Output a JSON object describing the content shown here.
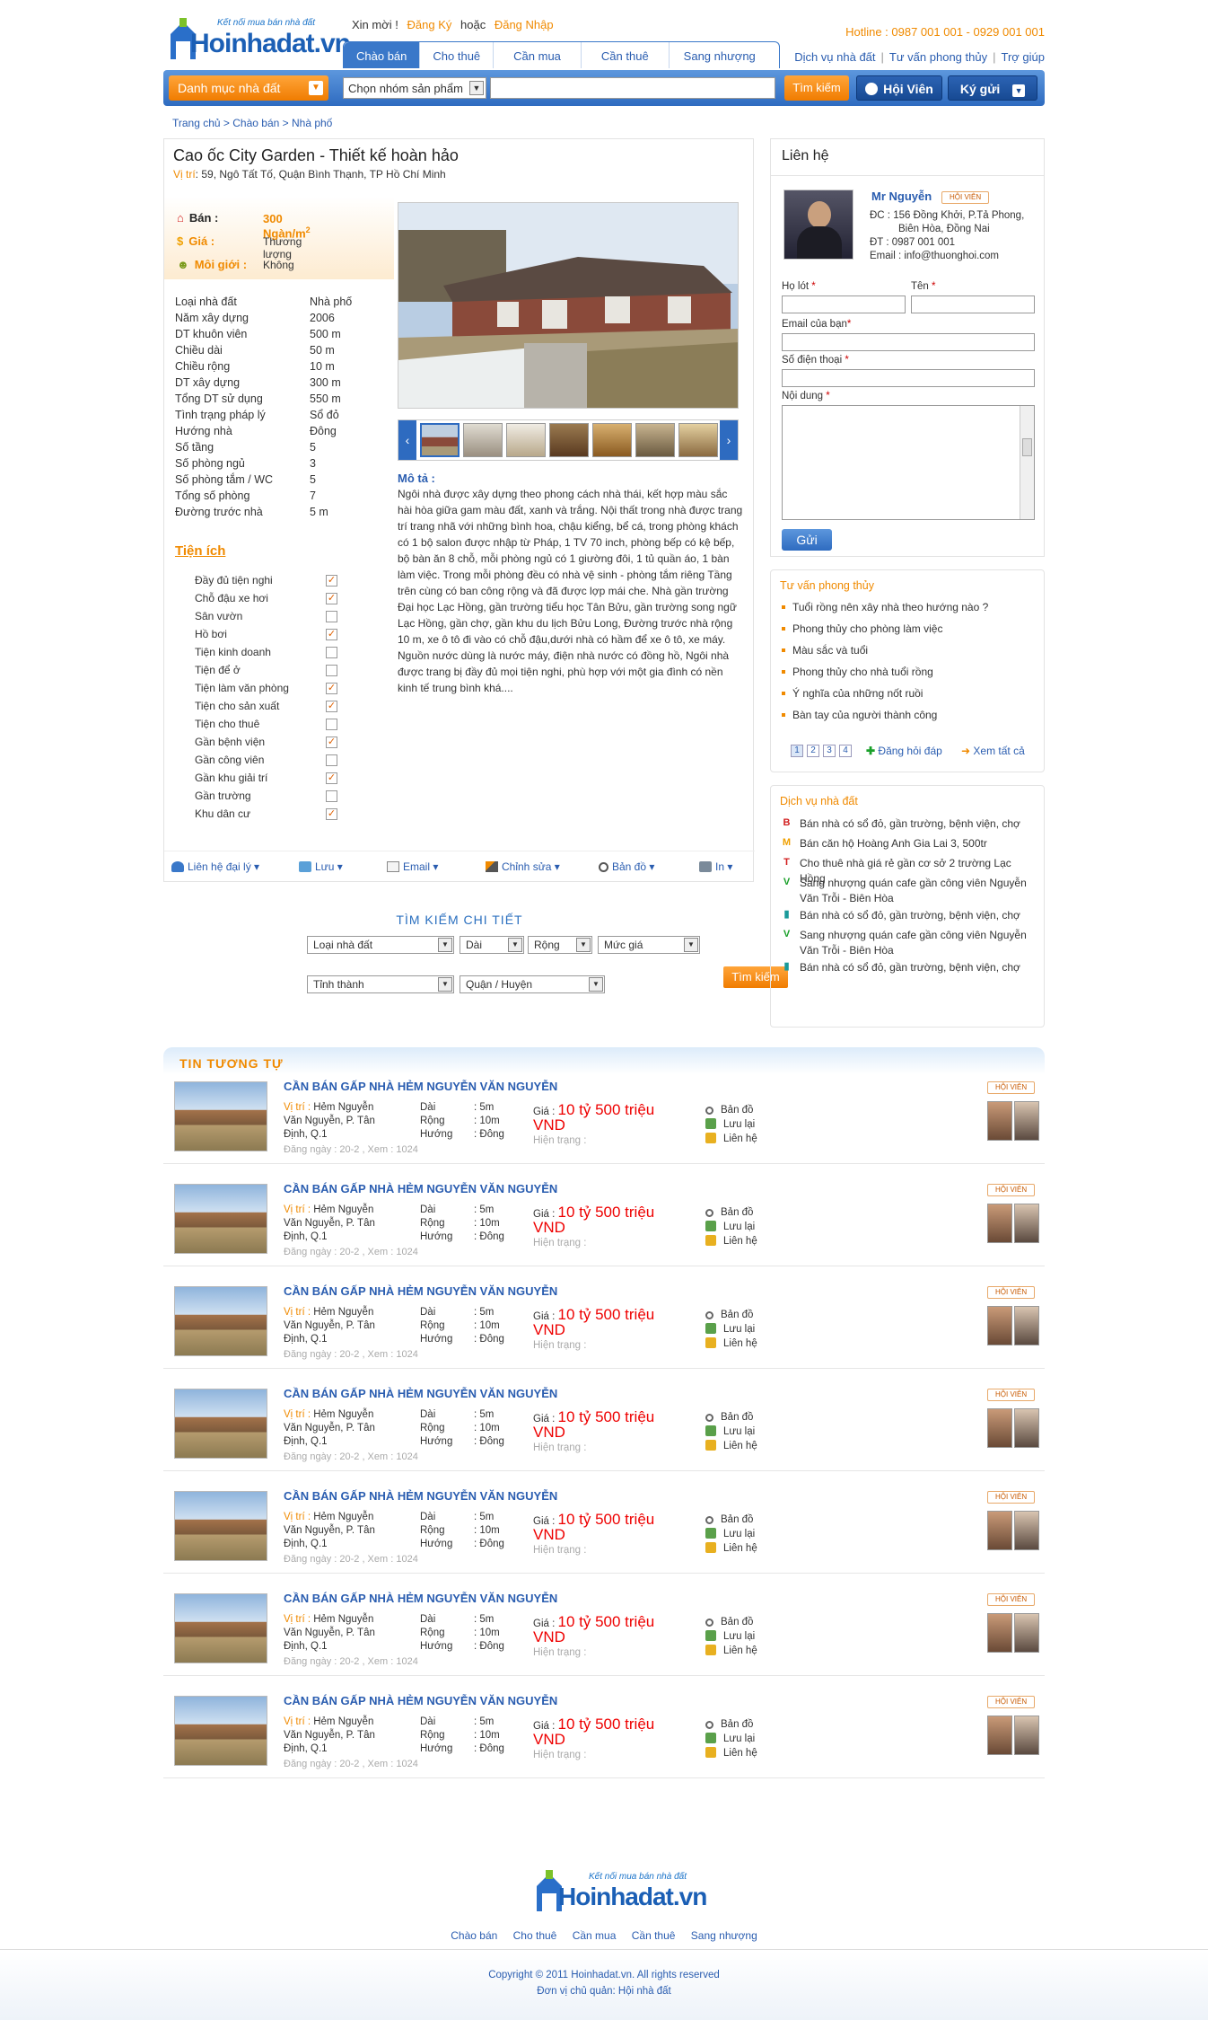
{
  "header": {
    "logo_tagline": "Kết nối mua bán nhà đất",
    "logo_text": "Hoinhadat.vn",
    "greeting": "Xin mời !",
    "register": "Đăng Ký",
    "or": "hoặc",
    "login": "Đăng Nhập",
    "hotline": "Hotline : 0987 001 001 - 0929 001 001",
    "tabs": [
      "Chào bán",
      "Cho thuê",
      "Cần mua",
      "Cần thuê",
      "Sang nhượng"
    ],
    "links": [
      "Dịch vụ nhà đất",
      "Tư vấn phong thủy",
      "Trợ giúp"
    ]
  },
  "search": {
    "category": "Danh mục nhà đất",
    "group_select": "Chọn nhóm sản phẩm",
    "button": "Tìm kiếm",
    "member_button": "Hội Viên",
    "post_button": "Ký gửi"
  },
  "breadcrumb": "Trang chủ > Chào bán > Nhà phố",
  "listing": {
    "title": "Cao ốc City Garden - Thiết kế hoàn hảo",
    "location_label": "Vị trí",
    "location": ": 59, Ngô Tất Tố, Quận Bình Thạnh, TP Hồ Chí Minh",
    "price_rows": [
      {
        "label": "Bán :",
        "value": "300 Ngàn/m",
        "sup": "2"
      },
      {
        "label": "Giá :",
        "value": "Thương lượng"
      },
      {
        "label": "Môi giới :",
        "value": "Không"
      }
    ],
    "specs": [
      {
        "k": "Loại nhà đất",
        "v": "Nhà phố"
      },
      {
        "k": "Năm xây dựng",
        "v": "2006"
      },
      {
        "k": "DT khuôn viên",
        "v": "500 m"
      },
      {
        "k": "Chiều dài",
        "v": "50 m"
      },
      {
        "k": "Chiều rộng",
        "v": "10 m"
      },
      {
        "k": "DT xây dựng",
        "v": "300 m"
      },
      {
        "k": "Tổng DT sử dụng",
        "v": "550 m"
      },
      {
        "k": "Tình trạng pháp lý",
        "v": "Sổ đỏ"
      },
      {
        "k": "Hướng nhà",
        "v": "Đông"
      },
      {
        "k": "Số tầng",
        "v": "5"
      },
      {
        "k": "Số phòng ngủ",
        "v": "3"
      },
      {
        "k": "Số phòng tắm / WC",
        "v": "5"
      },
      {
        "k": "Tổng số phòng",
        "v": "7"
      },
      {
        "k": "Đường trước nhà",
        "v": "5 m"
      }
    ],
    "amenities_title": "Tiện ích",
    "amenities": [
      {
        "name": "Đầy đủ tiện nghi",
        "checked": true
      },
      {
        "name": "Chỗ đậu xe hơi",
        "checked": true
      },
      {
        "name": "Sân vườn",
        "checked": false
      },
      {
        "name": "Hồ bơi",
        "checked": true
      },
      {
        "name": "Tiện kinh doanh",
        "checked": false
      },
      {
        "name": "Tiện để ở",
        "checked": false
      },
      {
        "name": "Tiện làm văn phòng",
        "checked": true
      },
      {
        "name": "Tiện cho sản xuất",
        "checked": true
      },
      {
        "name": "Tiện cho thuê",
        "checked": false
      },
      {
        "name": "Gần bệnh viện",
        "checked": true
      },
      {
        "name": "Gần công viên",
        "checked": false
      },
      {
        "name": "Gần khu giải trí",
        "checked": true
      },
      {
        "name": "Gần trường",
        "checked": false
      },
      {
        "name": "Khu dân cư",
        "checked": true
      }
    ],
    "desc_title": "Mô tả :",
    "description": "Ngôi nhà được xây dựng theo phong cách nhà thái, kết hợp màu sắc hài hòa giữa gam màu đất, xanh và trắng. Nội thất trong nhà được trang trí trang nhã với những bình hoa, chậu kiểng, bể cá, trong phòng khách có 1 bộ salon được nhập từ Pháp, 1 TV 70 inch, phòng bếp có kệ bếp, bộ bàn ăn 8 chỗ, mỗi phòng ngủ có 1 giường đôi, 1 tủ quần áo, 1 bàn làm việc. Trong mỗi phòng đều có nhà vệ sinh - phòng tắm riêng Tầng trên cùng có ban công rộng và đã được lợp mái che. Nhà gần trường Đại học Lạc Hồng, gần trường tiểu học Tân Bửu, gần trường song ngữ Lạc Hồng, gần chợ, gần khu du lịch Bửu Long, Đường trước nhà rộng 10 m, xe ô tô đi vào có chỗ đậu,dưới nhà có hầm để xe ô tô, xe máy. Nguồn nước dùng là nước máy, điện nhà nước có đồng hồ, Ngôi nhà được trang bị đầy đủ mọi tiện nghi, phù hợp với một gia đình có nền kinh tế trung bình khá....",
    "actions": [
      "Liên hệ đại lý",
      "Lưu",
      "Email",
      "Chỉnh sửa",
      "Bản đồ",
      "In"
    ]
  },
  "detail_search": {
    "title": "TÌM KIẾM CHI TIẾT",
    "row1": [
      "Loại nhà đất",
      "Dài",
      "Rộng",
      "Mức giá"
    ],
    "row2": [
      "Tỉnh thành",
      "Quận / Huyện"
    ],
    "button": "Tìm kiếm"
  },
  "contact": {
    "title": "Liên hệ",
    "name": "Mr Nguyễn",
    "badge": "HỘI VIÊN",
    "address_1": "ĐC : 156 Đồng Khởi, P.Tả Phong,",
    "address_2": "Biên Hòa, Đồng Nai",
    "phone": "ĐT   :  0987 001 001",
    "email": "Email : info@thuonghoi.com",
    "f_lastname": "Họ lót",
    "f_firstname": "Tên",
    "f_email": "Email của bạn",
    "f_phone": "Số điện thoại",
    "f_content": "Nội dung",
    "send": "Gửi"
  },
  "fengshui": {
    "title": "Tư vấn phong thủy",
    "items": [
      "Tuổi rồng nên xây nhà theo hướng nào ?",
      "Phong thủy cho phòng làm việc",
      "Màu sắc và tuổi",
      "Phong thủy cho nhà tuổi rồng",
      "Ý nghĩa của những nốt ruồi",
      "Bàn tay của người thành công"
    ],
    "pages": [
      "1",
      "2",
      "3",
      "4"
    ],
    "ask": "Đăng hỏi đáp",
    "see_all": "Xem tất cả"
  },
  "services": {
    "title": "Dịch vụ nhà đất",
    "items": [
      {
        "icon": "B",
        "color": "#d21f1f",
        "text": "Bán nhà có sổ đỏ, gần trường, bệnh viện, chợ"
      },
      {
        "icon": "M",
        "color": "#f0a000",
        "text": "Bán căn hộ Hoàng Anh Gia Lai 3, 500tr"
      },
      {
        "icon": "T",
        "color": "#d21f1f",
        "text": "Cho thuê nhà giá rẻ gần cơ sở 2 trường Lạc Hồng"
      },
      {
        "icon": "V",
        "color": "#1aa02a",
        "text": "Sang nhượng quán cafe gần công viên Nguyễn Văn Trỗi - Biên Hòa"
      },
      {
        "icon": "▮",
        "color": "#1a9a9a",
        "text": "Bán nhà có sổ đỏ, gần trường, bệnh viện, chợ"
      },
      {
        "icon": "V",
        "color": "#1aa02a",
        "text": "Sang nhượng quán cafe gần công viên Nguyễn Văn Trỗi - Biên Hòa"
      },
      {
        "icon": "▮",
        "color": "#1a9a9a",
        "text": "Bán nhà có sổ đỏ, gần trường, bệnh viện, chợ"
      }
    ]
  },
  "related": {
    "title": "TIN TƯƠNG TỰ",
    "item": {
      "title": "CẦN BÁN GẤP NHÀ HẺM NGUYỄN VĂN NGUYỄN",
      "loc_label": "Vị trí :",
      "loc": "Hẻm Nguyễn Văn Nguyễn, P. Tân Định, Q.1",
      "date": "Đăng ngày : 20-2  ,   Xem : 1024",
      "dims": [
        {
          "k": "Dài",
          "v": ":  5m"
        },
        {
          "k": "Rộng",
          "v": ":  10m"
        },
        {
          "k": "Hướng",
          "v": ":  Đông"
        }
      ],
      "price_label": "Giá :",
      "price_1": "10 tỷ 500 triệu",
      "price_2": "VND",
      "status": "Hiện trạng :",
      "acts": [
        "Bản đồ",
        "Lưu lại",
        "Liên hệ"
      ],
      "badge": "HỘI VIÊN"
    }
  },
  "footer": {
    "nav": [
      "Chào bán",
      "Cho thuê",
      "Cần mua",
      "Cần thuê",
      "Sang nhượng"
    ],
    "copyright": "Copyright © 2011 Hoinhadat.vn. All rights reserved",
    "owner": "Đơn vị chủ quản: Hội nhà đất"
  }
}
